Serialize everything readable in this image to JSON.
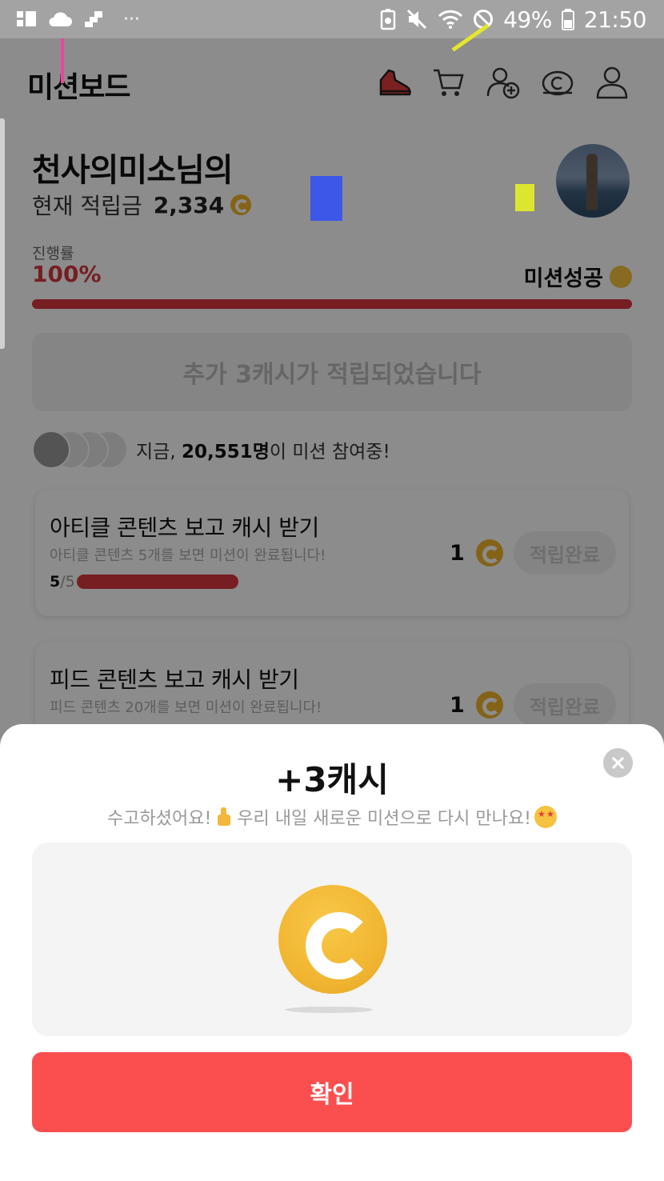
{
  "status_bar": {
    "battery_pct": "49%",
    "time": "21:50",
    "more_dots": "···"
  },
  "header": {
    "title": "미션보드",
    "icons": [
      "sneaker-icon",
      "cart-icon",
      "add-friend-icon",
      "cash-icon",
      "profile-icon"
    ]
  },
  "user": {
    "name": "천사의미소님의",
    "cash_label": "현재 적립금",
    "cash_value": "2,334"
  },
  "progress": {
    "label": "진행률",
    "percent_text": "100%",
    "value": 1.0,
    "status": "미션성공"
  },
  "banner": {
    "text": "추가 3캐시가 적립되었습니다"
  },
  "participants": {
    "prefix": "지금, ",
    "count": "20,551명",
    "suffix": "이 미션 참여중!"
  },
  "missions": [
    {
      "title": "아티클 콘텐츠 보고 캐시 받기",
      "desc": "아티클 콘텐츠 5개를 보면 미션이 완료됩니다!",
      "done": "5",
      "total": "/5",
      "reward": "1",
      "button": "적립완료"
    },
    {
      "title": "피드 콘텐츠 보고 캐시 받기",
      "desc": "피드 콘텐츠 20개를 보면 미션이 완료됩니다!",
      "reward": "1",
      "button": "적립완료"
    }
  ],
  "sheet": {
    "title": "+3캐시",
    "sub_part1": "수고하셨어요!",
    "sub_part2": " 우리 내일 새로운 미션으로 다시 만나요!",
    "confirm_label": "확인"
  },
  "colors": {
    "accent": "#fb4f4f",
    "progress": "#d7373f",
    "coin": "#f0b429"
  }
}
